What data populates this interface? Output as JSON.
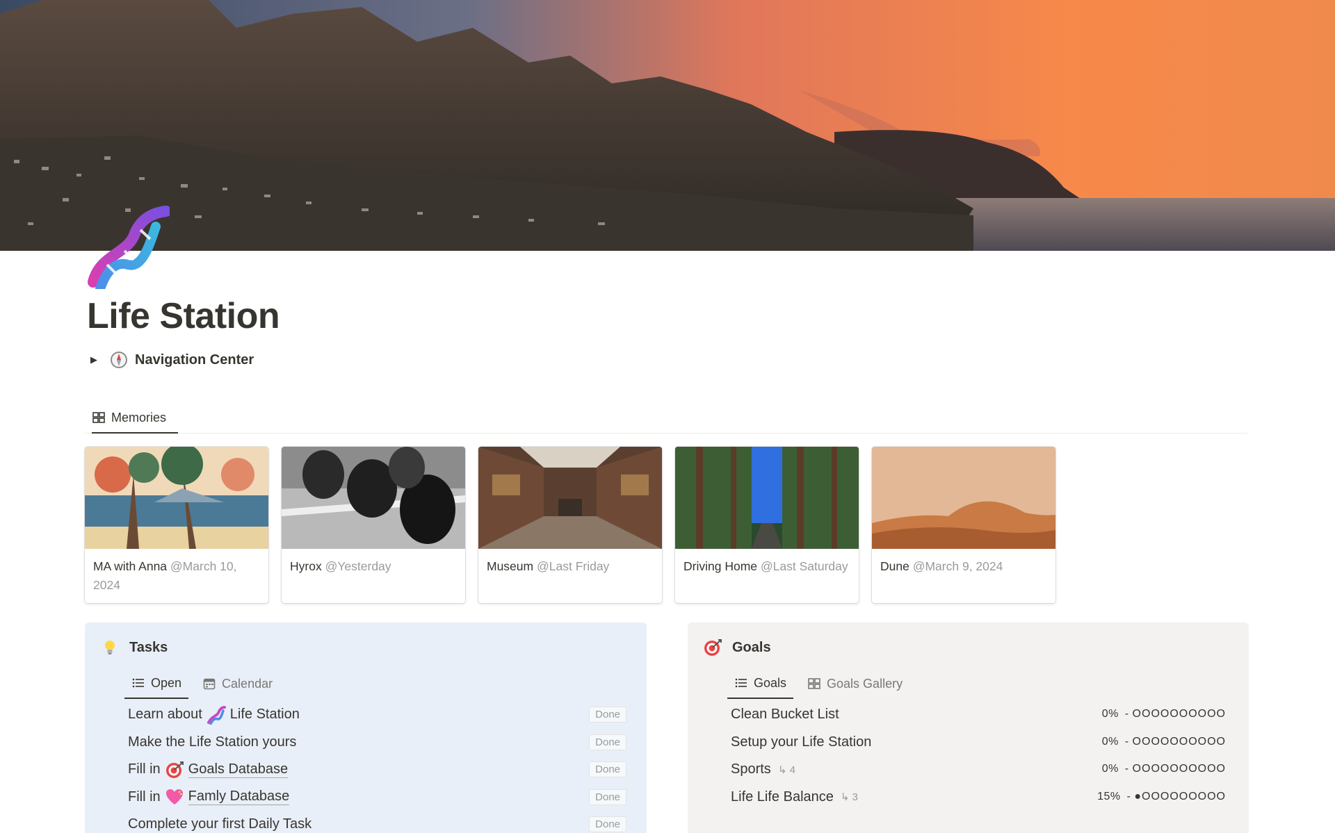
{
  "page": {
    "title": "Life Station",
    "icon": "dna-icon"
  },
  "navigation": {
    "label": "Navigation Center",
    "icon": "compass-icon",
    "collapsed": true
  },
  "memories": {
    "tab_label": "Memories",
    "cards": [
      {
        "title": "MA with Anna",
        "date": "@March 10, 2024",
        "thumb": "japanese-woodblock"
      },
      {
        "title": "Hyrox",
        "date": "@Yesterday",
        "thumb": "runners-bw"
      },
      {
        "title": "Museum",
        "date": "@Last Friday",
        "thumb": "museum-hall"
      },
      {
        "title": "Driving Home",
        "date": "@Last Saturday",
        "thumb": "forest-road"
      },
      {
        "title": "Dune",
        "date": "@March 9, 2024",
        "thumb": "desert-dunes"
      }
    ]
  },
  "tasks": {
    "title": "Tasks",
    "icon": "lightbulb-icon",
    "tabs": [
      {
        "label": "Open",
        "icon": "list-icon",
        "active": true
      },
      {
        "label": "Calendar",
        "icon": "calendar-icon",
        "active": false
      }
    ],
    "done_label": "Done",
    "rows": [
      {
        "pre": "Learn about",
        "emoji": "dna-icon",
        "link": "Life Station",
        "underline": false
      },
      {
        "pre": "Make the Life Station yours",
        "emoji": "",
        "link": "",
        "underline": false
      },
      {
        "pre": "Fill in",
        "emoji": "target-icon",
        "link": "Goals Database",
        "underline": true
      },
      {
        "pre": "Fill in",
        "emoji": "heart-icon",
        "link": "Famly Database",
        "underline": true
      },
      {
        "pre": "Complete your first Daily Task",
        "emoji": "",
        "link": "",
        "underline": false
      }
    ]
  },
  "goals": {
    "title": "Goals",
    "icon": "target-icon",
    "tabs": [
      {
        "label": "Goals",
        "icon": "list-icon",
        "active": true
      },
      {
        "label": "Goals Gallery",
        "icon": "gallery-icon",
        "active": false
      }
    ],
    "rows": [
      {
        "name": "Clean Bucket List",
        "subcount": "",
        "percent": "0%",
        "progress": 0.0
      },
      {
        "name": "Setup your Life Station",
        "subcount": "",
        "percent": "0%",
        "progress": 0.0
      },
      {
        "name": "Sports",
        "subcount": "4",
        "percent": "0%",
        "progress": 0.0
      },
      {
        "name": "Life Life Balance",
        "subcount": "3",
        "percent": "15%",
        "progress": 0.15
      }
    ]
  }
}
